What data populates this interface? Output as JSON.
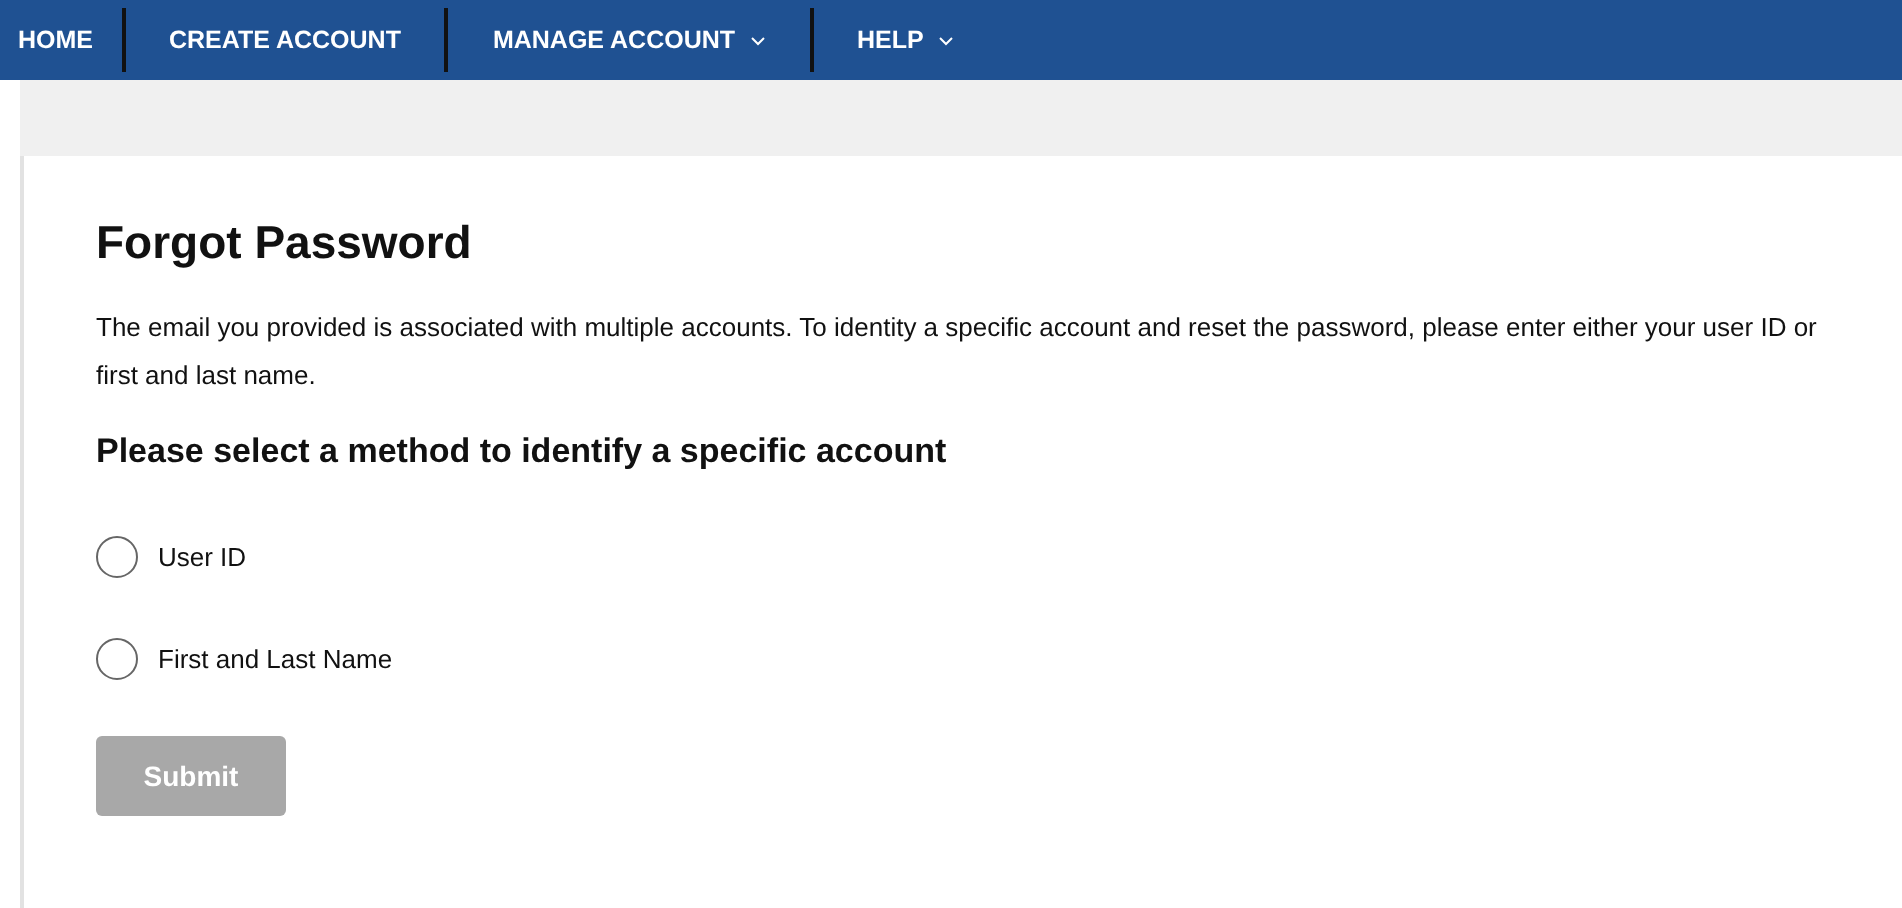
{
  "nav": [
    {
      "label": "HOME",
      "has_menu": false
    },
    {
      "label": "CREATE ACCOUNT",
      "has_menu": false
    },
    {
      "label": "MANAGE ACCOUNT",
      "has_menu": true
    },
    {
      "label": "HELP",
      "has_menu": true
    }
  ],
  "title": "Forgot Password",
  "intro": "The email you provided is associated with multiple accounts. To identity a specific account and reset the password, please enter either your user ID or first and last name.",
  "method_heading": "Please select a method to identify a specific account",
  "methods": [
    {
      "label": "User ID",
      "selected": false
    },
    {
      "label": "First and Last Name",
      "selected": false
    }
  ],
  "submit": {
    "label": "Submit",
    "disabled": true
  }
}
